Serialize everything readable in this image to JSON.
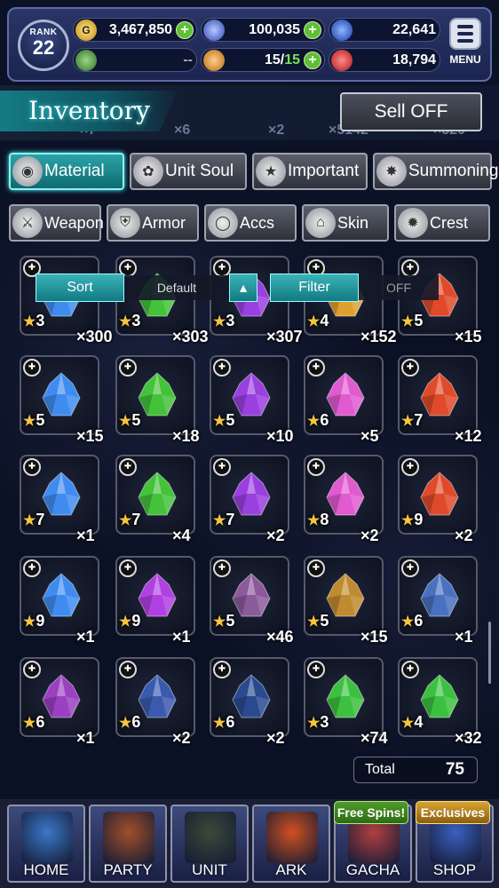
{
  "hud": {
    "rank_label": "RANK",
    "rank_value": "22",
    "gil": "3,467,850",
    "crystals": "100,035",
    "orbs": "22,641",
    "unknown_value": "--",
    "stamina": "15",
    "stamina_max": "15",
    "red_currency": "18,794",
    "menu_label": "MENU"
  },
  "header": {
    "title": "Inventory",
    "sell_label": "Sell OFF",
    "ghost_counts": [
      "×7",
      "×6",
      "×2",
      "×5142",
      "×520"
    ]
  },
  "category_tabs": [
    {
      "label": "Material",
      "icon": "bag-icon",
      "active": true
    },
    {
      "label": "Unit Soul",
      "icon": "soul-icon",
      "active": false
    },
    {
      "label": "Important",
      "icon": "star-icon",
      "active": false
    },
    {
      "label": "Summoning",
      "icon": "summon-icon",
      "active": false
    }
  ],
  "equip_tabs": [
    {
      "label": "Weapon",
      "icon": "sword-icon"
    },
    {
      "label": "Armor",
      "icon": "armor-icon"
    },
    {
      "label": "Accs",
      "icon": "ring-icon"
    },
    {
      "label": "Skin",
      "icon": "hanger-icon"
    },
    {
      "label": "Crest",
      "icon": "crest-icon"
    }
  ],
  "sort": {
    "label": "Sort",
    "value": "Default"
  },
  "filter": {
    "label": "Filter",
    "value": "OFF"
  },
  "items": [
    {
      "rarity": "3",
      "qty": "×300",
      "color": "#3f8cf0"
    },
    {
      "rarity": "3",
      "qty": "×303",
      "color": "#44c23a"
    },
    {
      "rarity": "3",
      "qty": "×307",
      "color": "#9a3fe0"
    },
    {
      "rarity": "4",
      "qty": "×152",
      "color": "#e0a030"
    },
    {
      "rarity": "5",
      "qty": "×15",
      "color": "#e04a2a"
    },
    {
      "rarity": "5",
      "qty": "×15",
      "color": "#3f8cf0"
    },
    {
      "rarity": "5",
      "qty": "×18",
      "color": "#44c23a"
    },
    {
      "rarity": "5",
      "qty": "×10",
      "color": "#9a3fe0"
    },
    {
      "rarity": "6",
      "qty": "×5",
      "color": "#e05ad0"
    },
    {
      "rarity": "7",
      "qty": "×12",
      "color": "#e04a2a"
    },
    {
      "rarity": "7",
      "qty": "×1",
      "color": "#3f8cf0"
    },
    {
      "rarity": "7",
      "qty": "×4",
      "color": "#44c23a"
    },
    {
      "rarity": "7",
      "qty": "×2",
      "color": "#9a3fe0"
    },
    {
      "rarity": "8",
      "qty": "×2",
      "color": "#e05ad0"
    },
    {
      "rarity": "9",
      "qty": "×2",
      "color": "#e04a2a"
    },
    {
      "rarity": "9",
      "qty": "×1",
      "color": "#3f8cf0"
    },
    {
      "rarity": "9",
      "qty": "×1",
      "color": "#b040e0"
    },
    {
      "rarity": "5",
      "qty": "×46",
      "color": "#8a5a9a"
    },
    {
      "rarity": "5",
      "qty": "×15",
      "color": "#c08a30"
    },
    {
      "rarity": "6",
      "qty": "×1",
      "color": "#4a70c0"
    },
    {
      "rarity": "6",
      "qty": "×1",
      "color": "#9a40c0"
    },
    {
      "rarity": "6",
      "qty": "×2",
      "color": "#3a5ab0"
    },
    {
      "rarity": "6",
      "qty": "×2",
      "color": "#2a4a90"
    },
    {
      "rarity": "3",
      "qty": "×74",
      "color": "#3cc040"
    },
    {
      "rarity": "4",
      "qty": "×32",
      "color": "#3cc040"
    }
  ],
  "total": {
    "label": "Total",
    "value": "75"
  },
  "nav": [
    {
      "label": "HOME",
      "color": "#3a78c8"
    },
    {
      "label": "PARTY",
      "color": "#a0502a"
    },
    {
      "label": "UNIT",
      "color": "#3a4a38"
    },
    {
      "label": "ARK",
      "color": "#d05020"
    },
    {
      "label": "GACHA",
      "color": "#b04040"
    },
    {
      "label": "SHOP",
      "color": "#3a60c0"
    }
  ],
  "nav_tags": {
    "gacha": "Free Spins!",
    "shop": "Exclusives"
  }
}
